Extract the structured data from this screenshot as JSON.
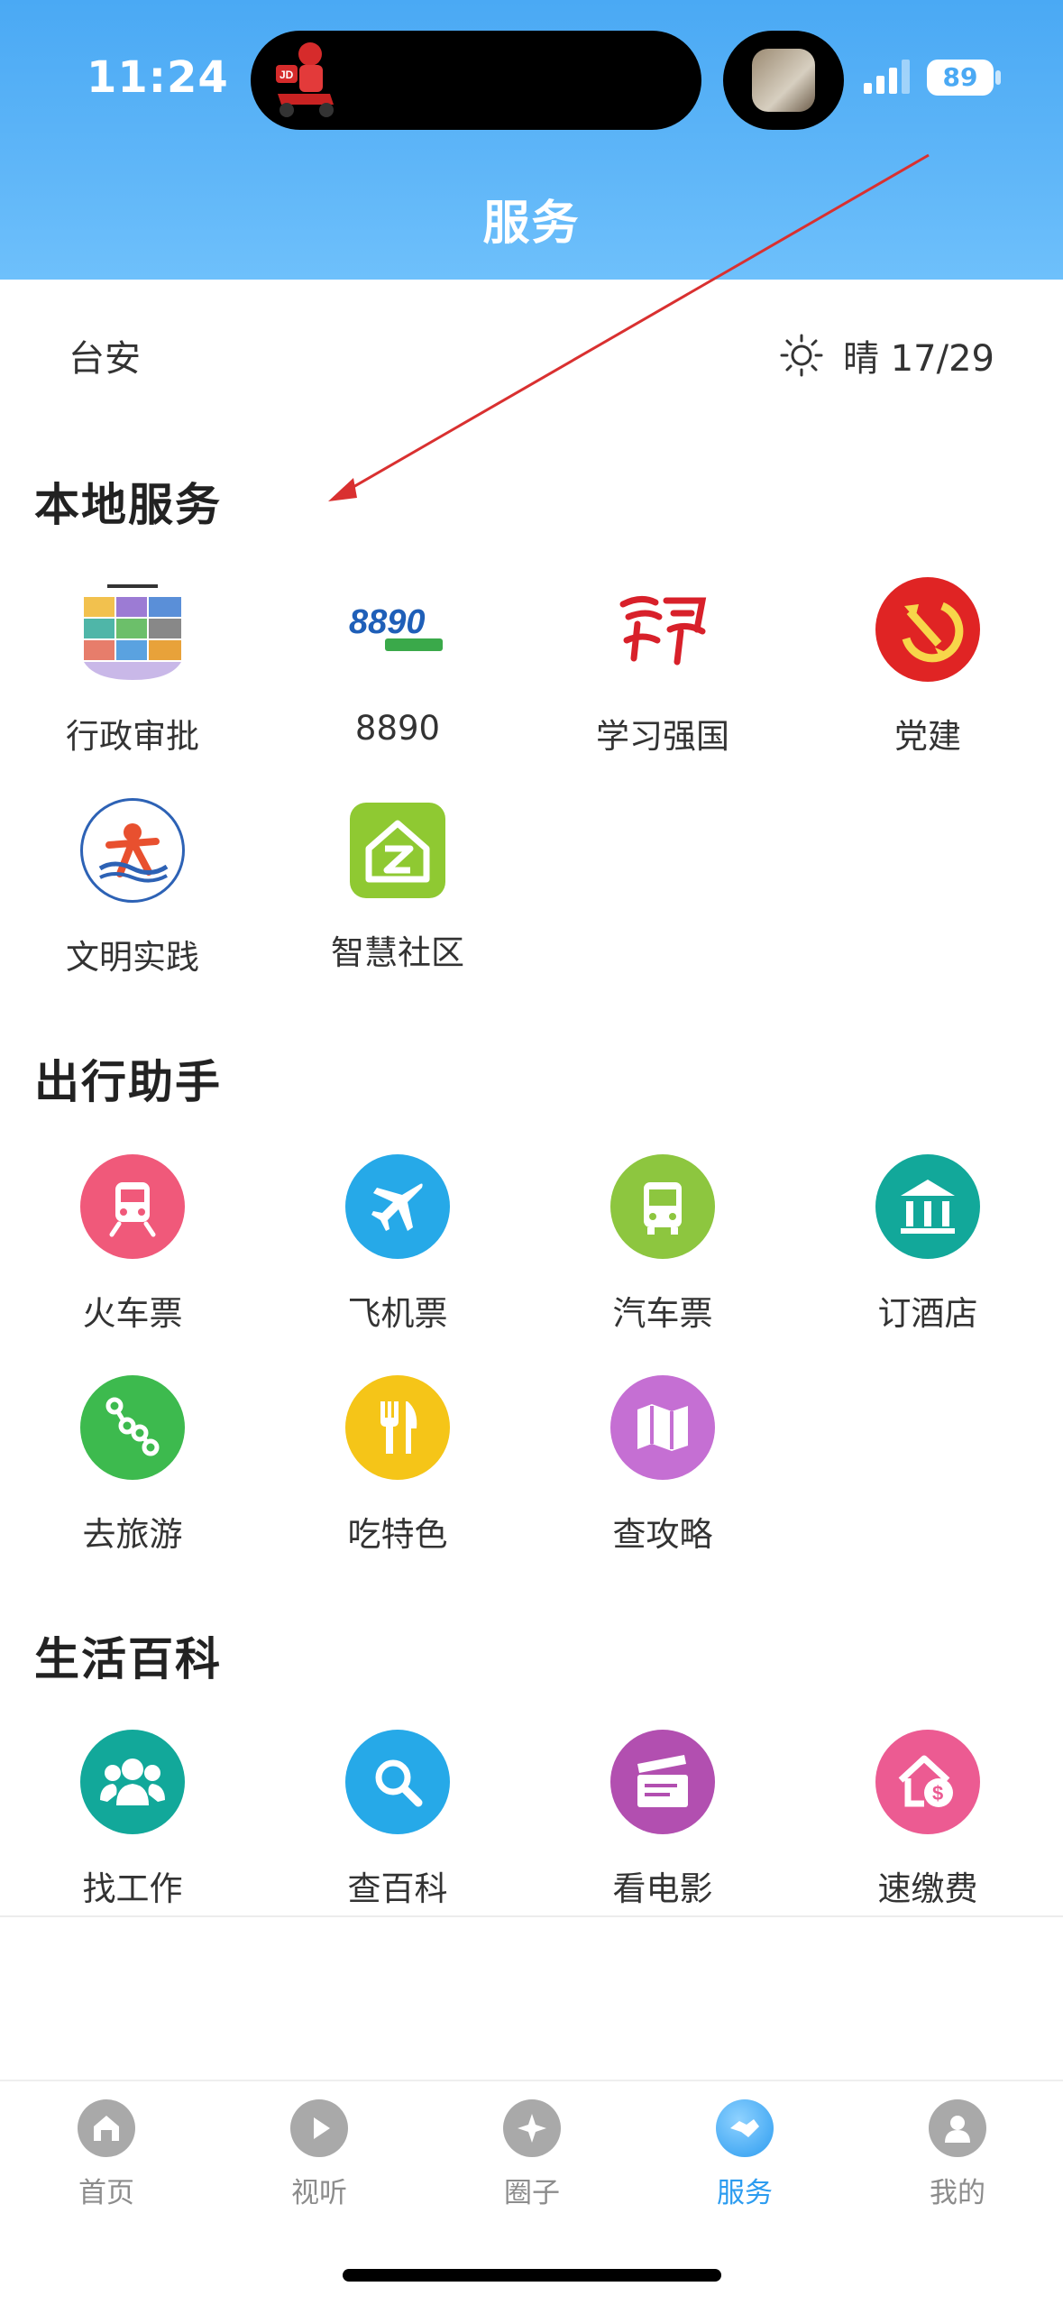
{
  "status_bar": {
    "time": "11:24",
    "battery": "89"
  },
  "header": {
    "title": "服务"
  },
  "location": {
    "city": "台安",
    "weather": "晴 17/29"
  },
  "sections": [
    {
      "title": "本地服务",
      "items": [
        {
          "label": "行政审批",
          "icon": "admin-approval-icon"
        },
        {
          "label": "8890",
          "icon": "8890-logo-icon",
          "logo_text": "8890"
        },
        {
          "label": "学习强国",
          "icon": "xuexi-qiangguo-icon"
        },
        {
          "label": "党建",
          "icon": "party-emblem-icon"
        },
        {
          "label": "文明实践",
          "icon": "civilization-practice-icon"
        },
        {
          "label": "智慧社区",
          "icon": "smart-community-icon"
        }
      ]
    },
    {
      "title": "出行助手",
      "items": [
        {
          "label": "火车票",
          "icon": "train-icon",
          "color": "#f0597a"
        },
        {
          "label": "飞机票",
          "icon": "airplane-icon",
          "color": "#26a9e8"
        },
        {
          "label": "汽车票",
          "icon": "bus-icon",
          "color": "#8dc63f"
        },
        {
          "label": "订酒店",
          "icon": "hotel-icon",
          "color": "#12a89a"
        },
        {
          "label": "去旅游",
          "icon": "route-icon",
          "color": "#3dba4e"
        },
        {
          "label": "吃特色",
          "icon": "fork-knife-icon",
          "color": "#f5c518"
        },
        {
          "label": "查攻略",
          "icon": "map-icon",
          "color": "#c56fd3"
        }
      ]
    },
    {
      "title": "生活百科",
      "items": [
        {
          "label": "找工作",
          "icon": "people-icon",
          "color": "#12a89a"
        },
        {
          "label": "查百科",
          "icon": "search-icon",
          "color": "#26a9e8"
        },
        {
          "label": "看电影",
          "icon": "clapperboard-icon",
          "color": "#b24fb0"
        },
        {
          "label": "速缴费",
          "icon": "house-payment-icon",
          "color": "#ec5b92"
        }
      ]
    }
  ],
  "tabs": [
    {
      "label": "首页",
      "icon": "home-icon"
    },
    {
      "label": "视听",
      "icon": "play-icon"
    },
    {
      "label": "圈子",
      "icon": "circle-icon"
    },
    {
      "label": "服务",
      "icon": "handshake-icon",
      "active": true
    },
    {
      "label": "我的",
      "icon": "user-icon"
    }
  ],
  "colors": {
    "header_top": "#4aa9f4",
    "accent": "#2c9cf0",
    "annotation_arrow": "#d93030"
  }
}
